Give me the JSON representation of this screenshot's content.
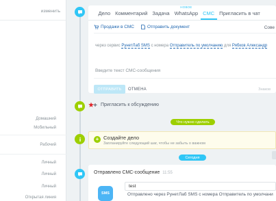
{
  "left_panel": {
    "change_link": "изменить",
    "phone_types": [
      "Домашний",
      "Мобильный",
      "Рабочий"
    ],
    "extra_labels": [
      "Личный",
      "Личный",
      "Личный",
      "Открытая линия"
    ]
  },
  "editor": {
    "tabs": [
      {
        "label": "Дело",
        "active": false
      },
      {
        "label": "Комментарий",
        "active": false
      },
      {
        "label": "Задача",
        "active": false
      },
      {
        "label": "WhatsApp",
        "active": false,
        "badge": "НОВОЕ"
      },
      {
        "label": "СМС",
        "active": true
      },
      {
        "label": "Пригласить в чат",
        "active": false
      }
    ],
    "tools": {
      "sell_label": "Продажи в СМС",
      "doc_label": "Отправить документ",
      "right_label": "Сове"
    },
    "via": {
      "prefix": "через сервис",
      "service": "РунетЛаб SMS",
      "from_text": "с номера",
      "sender": "Отправитель по умолчанию",
      "for_text": "для",
      "recipient": "Рябков Александр"
    },
    "message_placeholder": "Введите текст СМС-сообщения",
    "send_button": "ОТПРАВИТЬ",
    "cancel_button": "ОТМЕНА",
    "symbols_hint": "Знаков"
  },
  "invite": {
    "label": "Пригласить к обсуждению"
  },
  "badges": {
    "todo": "Что нужно сделать",
    "today": "Сегодня"
  },
  "task": {
    "title": "Создайте дело",
    "subtitle": "Запланируйте следующий шаг, чтобы не забыть о важном"
  },
  "sent_sms": {
    "title": "Отправлено СМС-сообщение",
    "time": "11:55",
    "icon_text": "SMS",
    "text": "test",
    "description": "Отправлено через РунетЛаб SMS с номера Отправитель по умолчани"
  },
  "colors": {
    "accent": "#2fc6f6",
    "green": "#9dcf00",
    "link": "#2067b0"
  }
}
